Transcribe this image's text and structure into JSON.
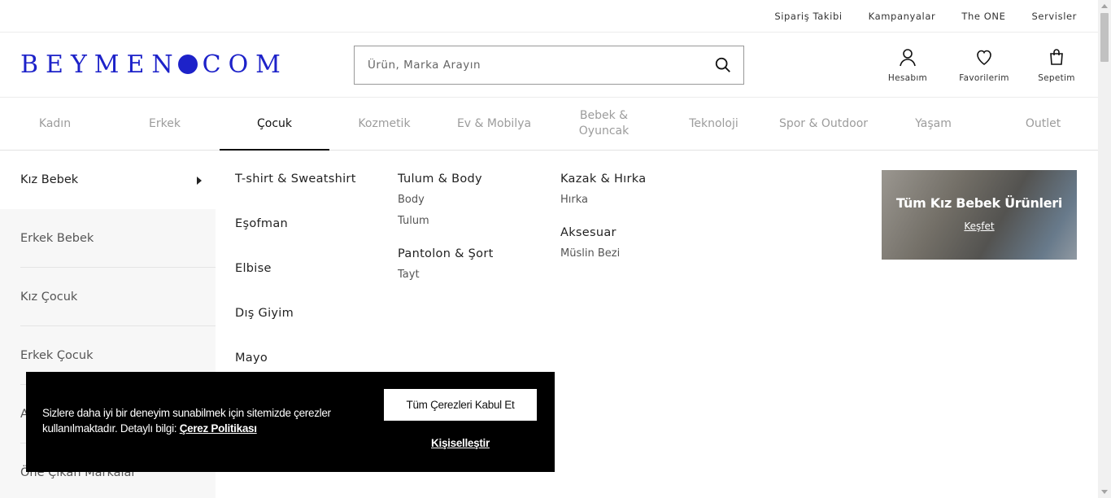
{
  "topbar": {
    "links": [
      "Sipariş Takibi",
      "Kampanyalar",
      "The ONE",
      "Servisler"
    ]
  },
  "header": {
    "logo_left": "BEYMEN",
    "logo_right": "COM",
    "search_placeholder": "Ürün, Marka Arayın",
    "account_label": "Hesabım",
    "favorites_label": "Favorilerim",
    "cart_label": "Sepetim",
    "brand_color": "#1d22c9"
  },
  "nav": {
    "items": [
      "Kadın",
      "Erkek",
      "Çocuk",
      "Kozmetik",
      "Ev & Mobilya",
      "Bebek & Oyuncak",
      "Teknoloji",
      "Spor & Outdoor",
      "Yaşam",
      "Outlet"
    ],
    "active": "Çocuk"
  },
  "sidebar": {
    "active": "Kız Bebek",
    "items": [
      "Erkek Bebek",
      "Kız Çocuk",
      "Erkek Çocuk",
      "A",
      "Öne Çıkan Markalar"
    ]
  },
  "menu": {
    "col1": [
      "T-shirt & Sweatshirt",
      "Eşofman",
      "Elbise",
      "Dış Giyim",
      "Mayo"
    ],
    "col2": [
      {
        "heading": "Tulum & Body",
        "subs": [
          "Body",
          "Tulum"
        ]
      },
      {
        "heading": "Pantolon & Şort",
        "subs": [
          "Tayt"
        ]
      }
    ],
    "col3": [
      {
        "heading": "Kazak & Hırka",
        "subs": [
          "Hırka"
        ]
      },
      {
        "heading": "Aksesuar",
        "subs": [
          "Müslin Bezi"
        ]
      }
    ]
  },
  "promo": {
    "title": "Tüm Kız Bebek Ürünleri",
    "link": "Keşfet"
  },
  "cookie": {
    "message_line1": "Sizlere daha iyi bir deneyim sunabilmek için sitemizde çerezler",
    "message_line2": "kullanılmaktadır. Detaylı bilgi:",
    "policy_link": "Çerez Politikası",
    "accept_label": "Tüm Çerezleri Kabul Et",
    "customize_label": "Kişiselleştir"
  }
}
